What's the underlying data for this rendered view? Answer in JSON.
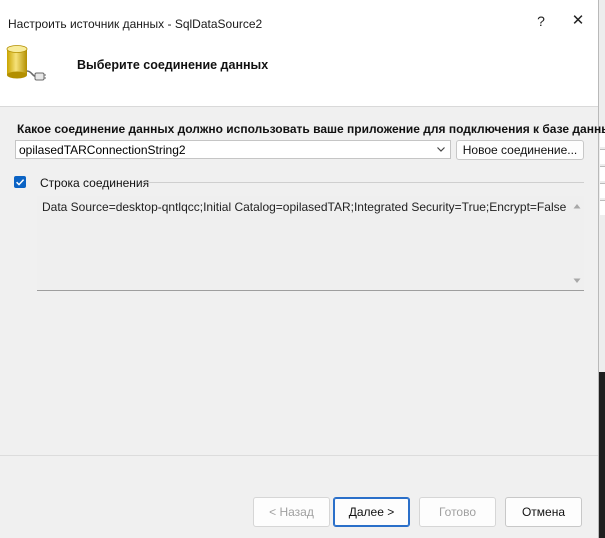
{
  "window": {
    "title": "Настроить источник данных - SqlDataSource2",
    "help_glyph": "?",
    "close_glyph": "✕"
  },
  "header": {
    "title": "Выберите соединение данных",
    "icon": "database-connection-icon"
  },
  "main": {
    "question": "Какое соединение данных должно использовать ваше приложение для подключения к базе данных?",
    "connection_select": {
      "value": "opilasedTARConnectionString2"
    },
    "new_connection_label": "Новое соединение...",
    "connection_string_group": {
      "checked": true,
      "label": "Строка соединения",
      "value": "Data Source=desktop-qntlqcc;Initial Catalog=opilasedTAR;Integrated Security=True;Encrypt=False"
    }
  },
  "footer": {
    "back_label": "< Назад",
    "next_label": "Далее >",
    "finish_label": "Готово",
    "cancel_label": "Отмена"
  },
  "colors": {
    "accent": "#0b63c4",
    "primary_border": "#2a6fc9",
    "disabled_text": "#a0a0a0"
  }
}
